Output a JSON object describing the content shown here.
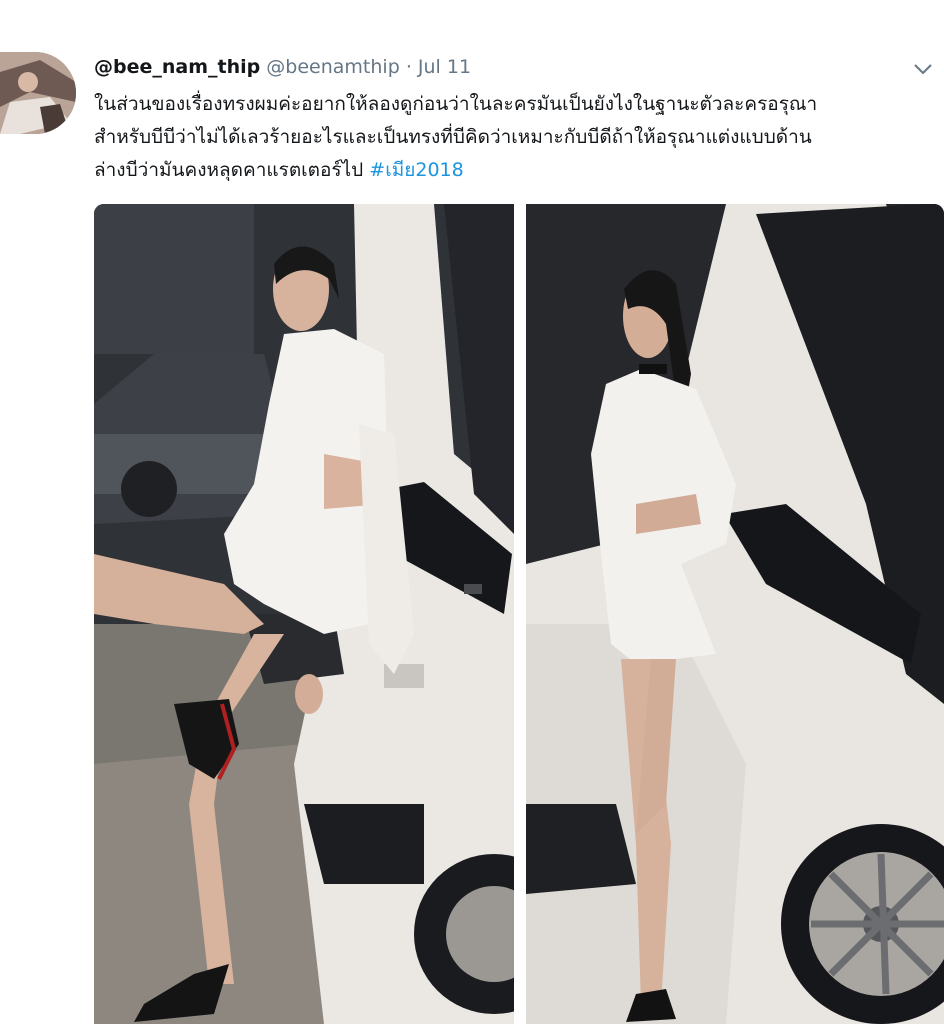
{
  "tweet": {
    "display_name": "@bee_nam_thip",
    "handle": "@beenamthip",
    "separator": "·",
    "date": "Jul 11",
    "text_lines": [
      "ในส่วนของเรื่องทรงผมค่ะอยากให้ลองดูก่อนว่าในละครมันเป็นยังไงในฐานะตัวละครอรุณา",
      "สำหรับบีบีว่าไม่ได้เลวร้ายอะไรและเป็นทรงที่บีคิดว่าเหมาะกับบีดีถ้าให้อรุณาแต่งแบบด้าน",
      "ล่างบีว่ามันคงหลุดคาแรตเตอร์ไป "
    ],
    "hashtag": "#เมีย2018"
  },
  "icons": {
    "menu": "chevron-down-icon"
  },
  "colors": {
    "link": "#1b95e0",
    "secondary_text": "#657786",
    "primary_text": "#14171a"
  }
}
